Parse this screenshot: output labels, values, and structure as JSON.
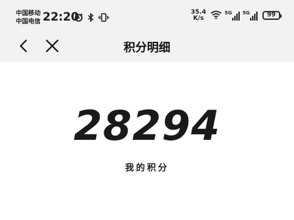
{
  "status_bar": {
    "carrier_1": "中国移动",
    "carrier_2": "中国电信",
    "time": "22:20",
    "net_speed_value": "35.4",
    "net_speed_unit": "K/s",
    "sim1_tag": "5G",
    "sim2_tag": "5G",
    "battery": "99",
    "icons": [
      "alarm-icon",
      "bluetooth-icon",
      "vibrate-icon",
      "wifi-icon",
      "signal-icon",
      "battery-icon"
    ]
  },
  "nav": {
    "title": "积分明细",
    "back_icon": "chevron-left-icon",
    "close_icon": "close-icon"
  },
  "main": {
    "points": "28294",
    "points_label": "我的积分"
  },
  "colors": {
    "header_bg": "#f2f2f2",
    "body_bg": "#ffffff",
    "text": "#1a1a1a"
  }
}
